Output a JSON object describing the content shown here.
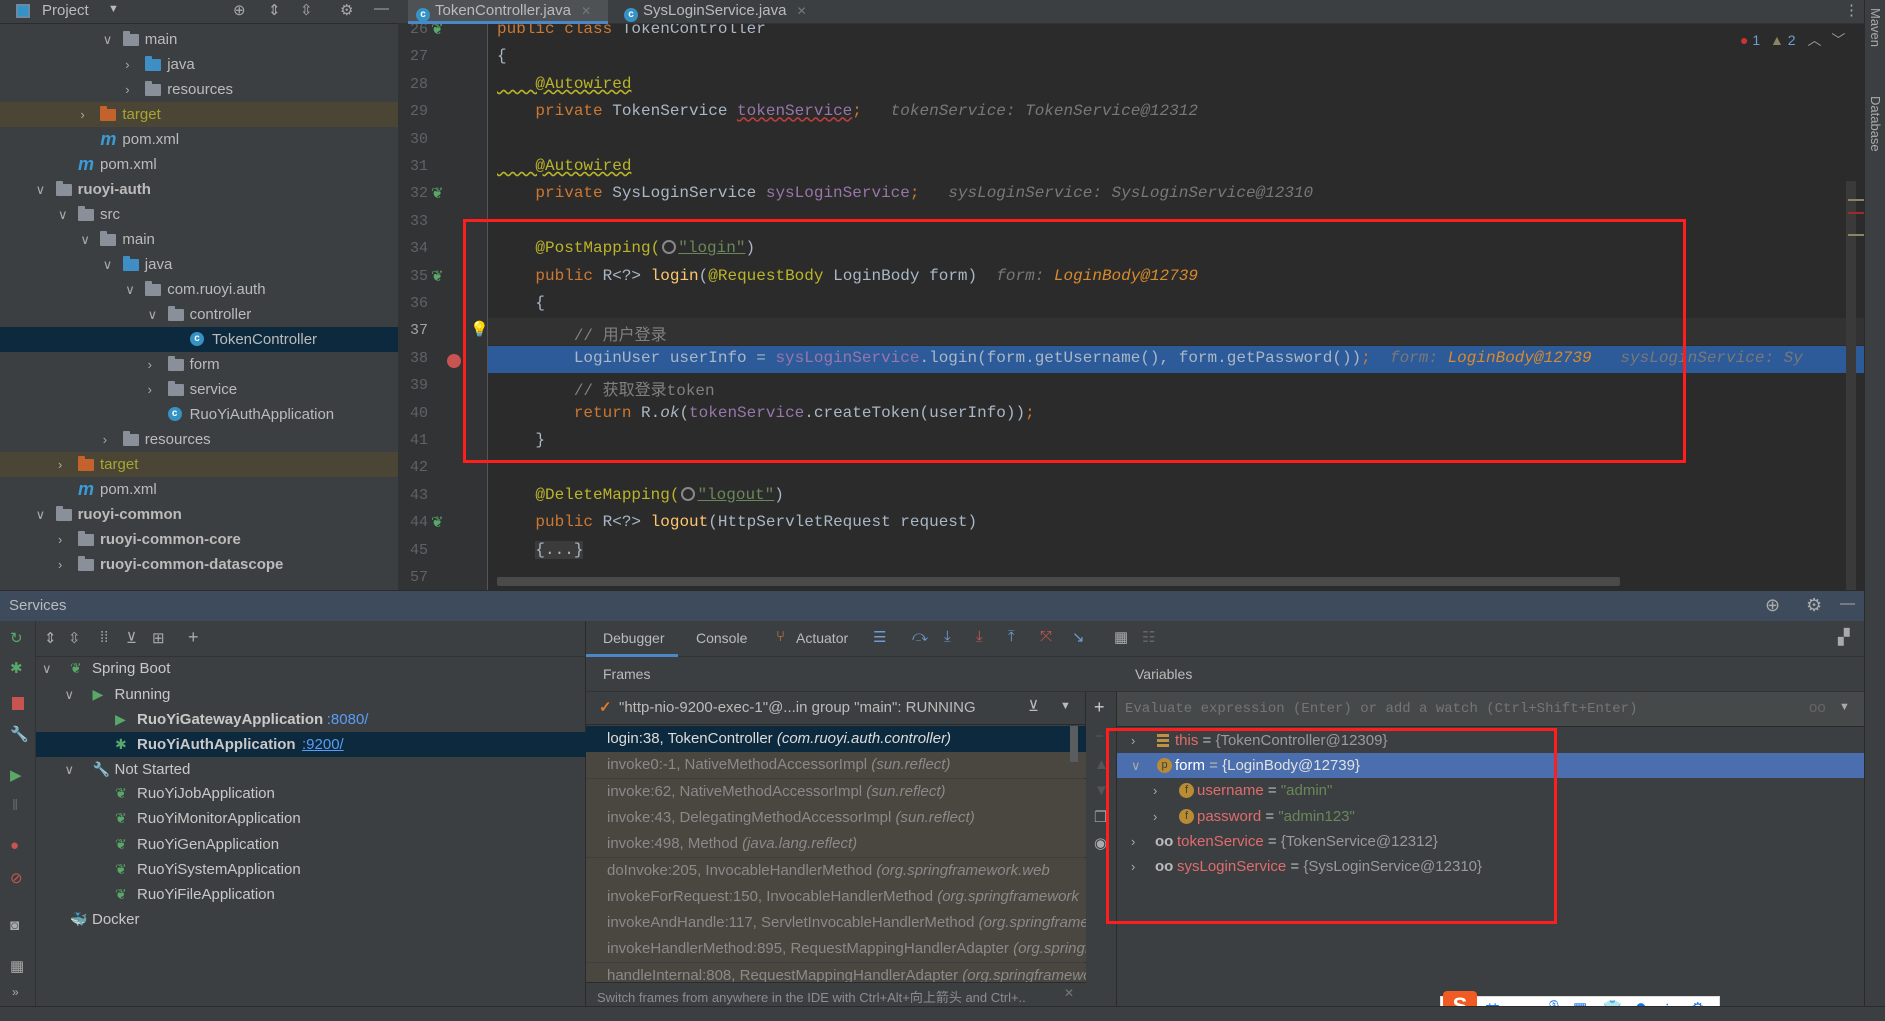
{
  "project_panel": {
    "title": "Project",
    "tree": [
      {
        "label": "main",
        "depth": 2,
        "type": "folder",
        "expanded": true
      },
      {
        "label": "java",
        "depth": 3,
        "type": "src",
        "expanded": false
      },
      {
        "label": "resources",
        "depth": 3,
        "type": "res",
        "expanded": false
      },
      {
        "label": "target",
        "depth": 1,
        "type": "excluded",
        "expanded": false
      },
      {
        "label": "pom.xml",
        "depth": 1,
        "type": "maven"
      },
      {
        "label": "pom.xml",
        "depth": 0,
        "type": "maven"
      },
      {
        "label": "ruoyi-auth",
        "depth": -1,
        "type": "module",
        "expanded": true
      },
      {
        "label": "src",
        "depth": 0,
        "type": "folder",
        "expanded": true
      },
      {
        "label": "main",
        "depth": 1,
        "type": "folder",
        "expanded": true
      },
      {
        "label": "java",
        "depth": 2,
        "type": "src",
        "expanded": true
      },
      {
        "label": "com.ruoyi.auth",
        "depth": 3,
        "type": "package",
        "expanded": true
      },
      {
        "label": "controller",
        "depth": 4,
        "type": "package",
        "expanded": true
      },
      {
        "label": "TokenController",
        "depth": 5,
        "type": "class",
        "selected": true
      },
      {
        "label": "form",
        "depth": 4,
        "type": "package",
        "expanded": false
      },
      {
        "label": "service",
        "depth": 4,
        "type": "package",
        "expanded": false
      },
      {
        "label": "RuoYiAuthApplication",
        "depth": 4,
        "type": "app"
      },
      {
        "label": "resources",
        "depth": 2,
        "type": "res",
        "expanded": false
      },
      {
        "label": "target",
        "depth": 0,
        "type": "excluded",
        "expanded": false
      },
      {
        "label": "pom.xml",
        "depth": 0,
        "type": "maven"
      },
      {
        "label": "ruoyi-common",
        "depth": -1,
        "type": "module",
        "expanded": true
      },
      {
        "label": "ruoyi-common-core",
        "depth": 0,
        "type": "module",
        "expanded": false
      },
      {
        "label": "ruoyi-common-datascope",
        "depth": 0,
        "type": "module",
        "expanded": false
      }
    ]
  },
  "editor": {
    "tabs": [
      {
        "label": "TokenController.java",
        "active": true
      },
      {
        "label": "SysLoginService.java",
        "active": false
      }
    ],
    "problems": {
      "errors": "1",
      "warnings": "2"
    },
    "current_line": "37",
    "execution_line": "38",
    "lines": [
      {
        "n": "26",
        "seg": [
          [
            "kw",
            "public class "
          ],
          [
            "p",
            "TokenController"
          ]
        ]
      },
      {
        "n": "27",
        "seg": [
          [
            "p",
            "{"
          ]
        ]
      },
      {
        "n": "28",
        "seg": [
          [
            "ann wavy",
            "    @Autowired"
          ]
        ]
      },
      {
        "n": "29",
        "seg": [
          [
            "kw",
            "    private "
          ],
          [
            "p",
            "TokenService "
          ],
          [
            "fld wavyr",
            "tokenService"
          ],
          [
            "kw",
            ";"
          ],
          [
            "hint",
            "   tokenService: TokenService@12312"
          ]
        ]
      },
      {
        "n": "30",
        "seg": []
      },
      {
        "n": "31",
        "seg": [
          [
            "ann wavy",
            "    @Autowired"
          ]
        ]
      },
      {
        "n": "32",
        "seg": [
          [
            "kw",
            "    private "
          ],
          [
            "p",
            "SysLoginService "
          ],
          [
            "fld",
            "sysLoginService"
          ],
          [
            "kw",
            ";"
          ],
          [
            "hint",
            "   sysLoginService: SysLoginService@12310"
          ]
        ]
      },
      {
        "n": "33",
        "seg": []
      },
      {
        "n": "34",
        "seg": [
          [
            "ann",
            "    @PostMapping("
          ],
          [
            "globe",
            ""
          ],
          [
            "str ul",
            "\"login\""
          ],
          [
            "p",
            ")"
          ]
        ]
      },
      {
        "n": "35",
        "seg": [
          [
            "kw",
            "    public "
          ],
          [
            "p",
            "R<?> "
          ],
          [
            "mth",
            "login"
          ],
          [
            "p",
            "("
          ],
          [
            "ann",
            "@RequestBody "
          ],
          [
            "p",
            "LoginBody form)"
          ],
          [
            "hint",
            "  form: "
          ],
          [
            "hv",
            "LoginBody@12739"
          ]
        ]
      },
      {
        "n": "36",
        "seg": [
          [
            "p",
            "    {"
          ]
        ]
      },
      {
        "n": "37",
        "seg": [
          [
            "cm",
            "        // 用户登录"
          ]
        ]
      },
      {
        "n": "38",
        "seg": [
          [
            "p",
            "        LoginUser userInfo = "
          ],
          [
            "fld",
            "sysLoginService"
          ],
          [
            "p",
            ".login(form.getUsername(), form.getPassword())"
          ],
          [
            "kw",
            ";"
          ],
          [
            "hint",
            "  form: "
          ],
          [
            "hv",
            "LoginBody@12739"
          ],
          [
            "hint",
            "   sysLoginService: Sy"
          ]
        ]
      },
      {
        "n": "39",
        "seg": [
          [
            "cm",
            "        // 获取登录token"
          ]
        ]
      },
      {
        "n": "40",
        "seg": [
          [
            "kw",
            "        return "
          ],
          [
            "p",
            "R."
          ],
          [
            "p it",
            "ok"
          ],
          [
            "p",
            "("
          ],
          [
            "fld",
            "tokenService"
          ],
          [
            "p",
            ".createToken(userInfo))"
          ],
          [
            "kw",
            ";"
          ]
        ]
      },
      {
        "n": "41",
        "seg": [
          [
            "p",
            "    }"
          ]
        ]
      },
      {
        "n": "42",
        "seg": []
      },
      {
        "n": "43",
        "seg": [
          [
            "ann",
            "    @DeleteMapping("
          ],
          [
            "globe",
            ""
          ],
          [
            "str ul",
            "\"logout\""
          ],
          [
            "p",
            ")"
          ]
        ]
      },
      {
        "n": "44",
        "seg": [
          [
            "kw",
            "    public "
          ],
          [
            "p",
            "R<?> "
          ],
          [
            "mth",
            "logout"
          ],
          [
            "p",
            "(HttpServletRequest request)"
          ]
        ]
      },
      {
        "n": "45",
        "seg": [
          [
            "p",
            "    "
          ],
          [
            "foldseg",
            "{...}"
          ]
        ]
      },
      {
        "n": "57",
        "seg": []
      }
    ]
  },
  "right_strip": {
    "maven": "Maven",
    "database": "Database"
  },
  "services": {
    "title": "Services",
    "tree": [
      {
        "label": "Spring Boot",
        "depth": 0,
        "bold": false
      },
      {
        "label": "Running",
        "depth": 1,
        "bold": false
      },
      {
        "label": "RuoYiGatewayApplication",
        "port": ":8080/",
        "depth": 2,
        "bold": true
      },
      {
        "label": "RuoYiAuthApplication",
        "port": ":9200/",
        "depth": 2,
        "bold": true,
        "selected": true
      },
      {
        "label": "Not Started",
        "depth": 1,
        "bold": false
      },
      {
        "label": "RuoYiJobApplication",
        "depth": 2
      },
      {
        "label": "RuoYiMonitorApplication",
        "depth": 2
      },
      {
        "label": "RuoYiGenApplication",
        "depth": 2
      },
      {
        "label": "RuoYiSystemApplication",
        "depth": 2
      },
      {
        "label": "RuoYiFileApplication",
        "depth": 2
      },
      {
        "label": "Docker",
        "depth": 0
      }
    ]
  },
  "debugger": {
    "tabs": [
      "Debugger",
      "Console",
      "Actuator"
    ],
    "frames_title": "Frames",
    "thread": "\"http-nio-9200-exec-1\"@...in group \"main\": RUNNING",
    "frames": [
      {
        "m": "login:38, TokenController ",
        "pkg": "(com.ruoyi.auth.controller)",
        "selected": true
      },
      {
        "m": "invoke0:-1, NativeMethodAccessorImpl ",
        "pkg": "(sun.reflect)"
      },
      {
        "m": "invoke:62, NativeMethodAccessorImpl ",
        "pkg": "(sun.reflect)"
      },
      {
        "m": "invoke:43, DelegatingMethodAccessorImpl ",
        "pkg": "(sun.reflect)"
      },
      {
        "m": "invoke:498, Method ",
        "pkg": "(java.lang.reflect)"
      },
      {
        "m": "doInvoke:205, InvocableHandlerMethod ",
        "pkg": "(org.springframework.web"
      },
      {
        "m": "invokeForRequest:150, InvocableHandlerMethod ",
        "pkg": "(org.springframework"
      },
      {
        "m": "invokeAndHandle:117, ServletInvocableHandlerMethod ",
        "pkg": "(org.springframework"
      },
      {
        "m": "invokeHandlerMethod:895, RequestMappingHandlerAdapter ",
        "pkg": "(org.springframework"
      },
      {
        "m": "handleInternal:808, RequestMappingHandlerAdapter ",
        "pkg": "(org.springframework"
      }
    ],
    "tip": "Switch frames from anywhere in the IDE with Ctrl+Alt+向上箭头 and Ctrl+..",
    "variables_title": "Variables",
    "eval_placeholder": "Evaluate expression (Enter) or add a watch (Ctrl+Shift+Enter)",
    "variables": [
      {
        "name": "this",
        "value": "{TokenController@12309}",
        "icon": "stack",
        "depth": 0,
        "expanded": false
      },
      {
        "name": "form",
        "value": "{LoginBody@12739}",
        "icon": "p",
        "depth": 0,
        "expanded": true,
        "selected": true
      },
      {
        "name": "username",
        "value": "\"admin\"",
        "icon": "f",
        "depth": 1,
        "expanded": false,
        "string": true
      },
      {
        "name": "password",
        "value": "\"admin123\"",
        "icon": "f",
        "depth": 1,
        "expanded": false,
        "string": true
      },
      {
        "name": "tokenService",
        "value": "{TokenService@12312}",
        "icon": "oo",
        "depth": 0,
        "expanded": false
      },
      {
        "name": "sysLoginService",
        "value": "{SysLoginService@12310}",
        "icon": "oo",
        "depth": 0,
        "expanded": false
      }
    ]
  },
  "ime": {
    "label": "英"
  },
  "colors": {
    "accent": "#4b6eaf",
    "execution_line": "#2d5b99",
    "annotation_box": "#ff1e1e"
  }
}
